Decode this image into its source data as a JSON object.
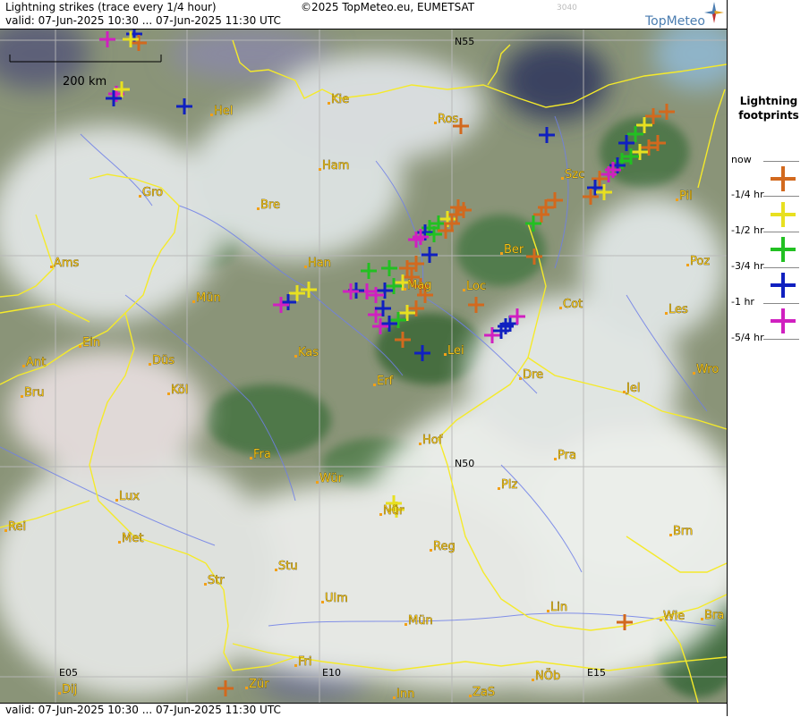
{
  "header": {
    "title": "Lightning strikes (trace every 1/4 hour)",
    "valid": "valid:  07-Jun-2025 10:30 ... 07-Jun-2025 11:30 UTC",
    "copyright": "©2025 TopMeteo.eu, EUMETSAT",
    "faint_code": "3040",
    "brand": "TopMeteo"
  },
  "footer": {
    "valid": "valid:  07-Jun-2025 10:30 ... 07-Jun-2025 11:30 UTC"
  },
  "scale": {
    "label": "200 km"
  },
  "grid_labels": {
    "n55": "N55",
    "n50": "N50",
    "e05": "E05",
    "e10": "E10",
    "e15": "E15"
  },
  "cities": [
    "Hel",
    "Kie",
    "Ros",
    "Ham",
    "Gro",
    "Bre",
    "Szc",
    "Pil",
    "Ber",
    "Ams",
    "Han",
    "Poz",
    "Mün",
    "Mag",
    "Loc",
    "Cot",
    "Les",
    "Ein",
    "Kas",
    "Lei",
    "Ant",
    "Düs",
    "Dre",
    "Wro",
    "Bru",
    "Köl",
    "Erf",
    "Jel",
    "Hof",
    "Fra",
    "Pra",
    "N50",
    "Wür",
    "Plz",
    "Lux",
    "Nür",
    "Rei",
    "Met",
    "Brn",
    "Reg",
    "Stu",
    "Str",
    "Ulm",
    "Lin",
    "Mün",
    "Wie",
    "Bra",
    "Fri",
    "Zür",
    "Dij",
    "Inn",
    "ZaS",
    "NÖb"
  ],
  "legend": {
    "title_line1": "Lightning",
    "title_line2": "footprints",
    "items": [
      {
        "label": "now",
        "color": "#d2691e"
      },
      {
        "label": "-1/4 hr",
        "color": "#e8e020"
      },
      {
        "label": "-1/2 hr",
        "color": "#22c022"
      },
      {
        "label": "-3/4 hr",
        "color": "#1020c0"
      },
      {
        "label": "-1 hr",
        "color": "#d020c0"
      },
      {
        "label": "-5/4 hr",
        "color": ""
      }
    ]
  },
  "colors": {
    "border": "#f5ea2a",
    "river": "#6f7fe8",
    "city_text": "#f2c21a",
    "grid": "#b8b8b8"
  }
}
